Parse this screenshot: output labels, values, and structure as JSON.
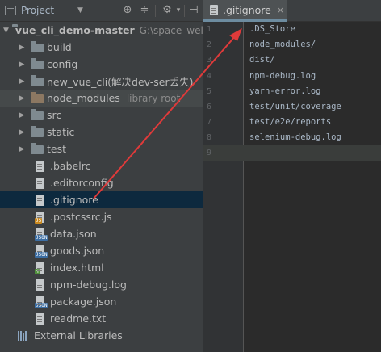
{
  "project_pane": {
    "title": "Project",
    "dropdown_icon": "caret-down-icon",
    "toolbar": [
      "target-icon",
      "collapse-icon",
      "gear-icon",
      "hide-icon"
    ]
  },
  "tree": {
    "root": {
      "label": "vue_cli_demo-master",
      "path": "G:\\space_wel"
    },
    "folders": [
      {
        "label": "build"
      },
      {
        "label": "config"
      },
      {
        "label": "new_vue_cli(解决dev-ser丢失)"
      },
      {
        "label": "node_modules",
        "hint": "library root"
      },
      {
        "label": "src"
      },
      {
        "label": "static"
      },
      {
        "label": "test"
      }
    ],
    "files": [
      {
        "label": ".babelrc",
        "badge": ""
      },
      {
        "label": ".editorconfig",
        "badge": ""
      },
      {
        "label": ".gitignore",
        "badge": ""
      },
      {
        "label": ".postcssrc.js",
        "badge": "JS"
      },
      {
        "label": "data.json",
        "badge": "JSON"
      },
      {
        "label": "goods.json",
        "badge": "JSON"
      },
      {
        "label": "index.html",
        "badge": "H"
      },
      {
        "label": "npm-debug.log",
        "badge": ""
      },
      {
        "label": "package.json",
        "badge": "JSON"
      },
      {
        "label": "readme.txt",
        "badge": ""
      }
    ],
    "external": {
      "label": "External Libraries"
    }
  },
  "editor": {
    "tab": {
      "label": ".gitignore",
      "close": "×"
    },
    "lines": [
      {
        "num": "1",
        "text": ".DS_Store"
      },
      {
        "num": "2",
        "text": "node_modules/"
      },
      {
        "num": "3",
        "text": "dist/"
      },
      {
        "num": "4",
        "text": "npm-debug.log"
      },
      {
        "num": "5",
        "text": "yarn-error.log"
      },
      {
        "num": "6",
        "text": "test/unit/coverage"
      },
      {
        "num": "7",
        "text": "test/e2e/reports"
      },
      {
        "num": "8",
        "text": "selenium-debug.log"
      },
      {
        "num": "9",
        "text": ""
      }
    ]
  },
  "colors": {
    "accent_arrow": "#e03a3a",
    "selection": "#0d293e",
    "current_line": "#3a3d3b"
  }
}
